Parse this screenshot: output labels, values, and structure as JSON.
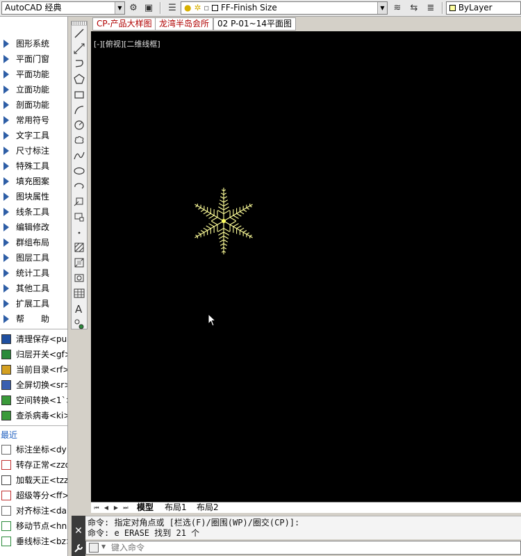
{
  "toolbar": {
    "workspace": "AutoCAD 经典",
    "layer_name": "FF-Finish Size",
    "color_value": "ByLayer"
  },
  "left_panel": {
    "menu_items": [
      "图形系统",
      "平面门窗",
      "平面功能",
      "立面功能",
      "剖面功能",
      "常用符号",
      "文字工具",
      "尺寸标注",
      "特殊工具",
      "填充图案",
      "图块属性",
      "线条工具",
      "编辑修改",
      "群组布局",
      "图层工具",
      "统计工具",
      "其他工具",
      "扩展工具",
      "帮　　助"
    ],
    "commands": [
      "清理保存<pu>",
      "归层开关<gf>",
      "当前目录<rf>",
      "全屏切换<sr>",
      "空间转换<1`>",
      "查杀病毒<ki>"
    ],
    "recent_label": "最近",
    "recent_commands": [
      "标注坐标<dy>",
      "转存正常<zzc",
      "加载天正<tzz",
      "超级等分<ff>",
      "对齐标注<da>",
      "移动节点<hnn",
      "垂线标注<bz>"
    ]
  },
  "file_tabs": [
    "CP-产品大样图",
    "龙湾半岛会所",
    "02 P-01~14平面图"
  ],
  "viewport": {
    "label": "[-][俯视][二维线框]"
  },
  "layout_tabs": [
    "模型",
    "布局1",
    "布局2"
  ],
  "command_line": {
    "history": [
      "命令: 指定对角点或 [栏选(F)/圈围(WP)/圈交(CP)]:",
      "命令: e ERASE 找到 21 个"
    ],
    "placeholder": "键入命令"
  }
}
